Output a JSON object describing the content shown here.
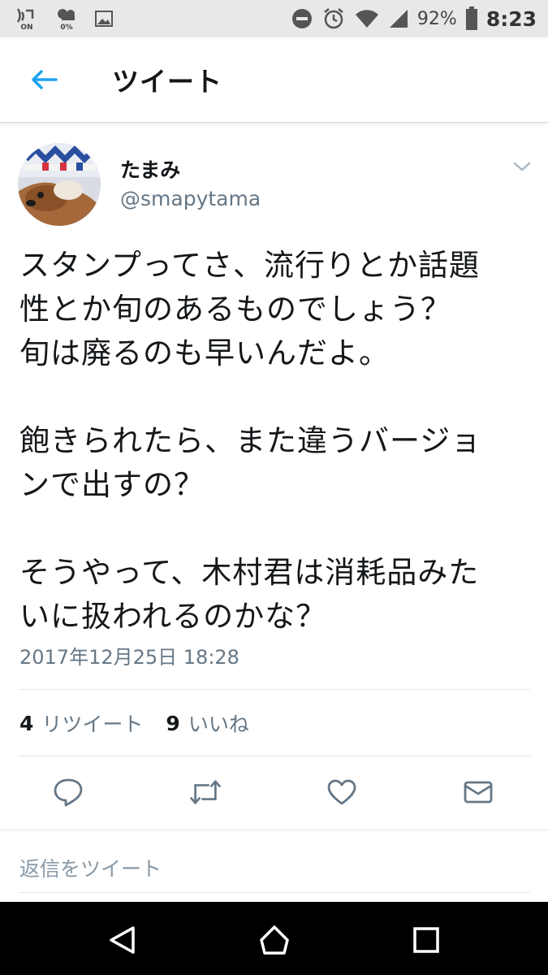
{
  "status_bar": {
    "left_icons": [
      "volte-icon",
      "data-saver-icon",
      "image-icon"
    ],
    "volte_label": "ON",
    "data_saver_label": "0%",
    "battery_percent": "92%",
    "time": "8:23"
  },
  "header": {
    "title": "ツイート"
  },
  "tweet": {
    "display_name": "たまみ",
    "handle": "@smapytama",
    "lines": [
      "スタンプってさ、流行りとか話題",
      "性とか旬のあるものでしょう？",
      "旬は廃るのも早いんだよ。",
      "",
      "飽きられたら、また違うバージョ",
      "ンで出すの？",
      "",
      "そうやって、木村君は消耗品みた",
      "いに扱われるのかな？"
    ],
    "timestamp": "2017年12月25日 18:28",
    "retweet_count": "4",
    "retweet_label": "リツイート",
    "like_count": "9",
    "like_label": "いいね"
  },
  "reply": {
    "placeholder": "返信をツイート"
  },
  "colors": {
    "accent": "#1da1f2",
    "secondary_text": "#657786",
    "icon_gray": "#657786",
    "divider": "#e1e8ed"
  }
}
